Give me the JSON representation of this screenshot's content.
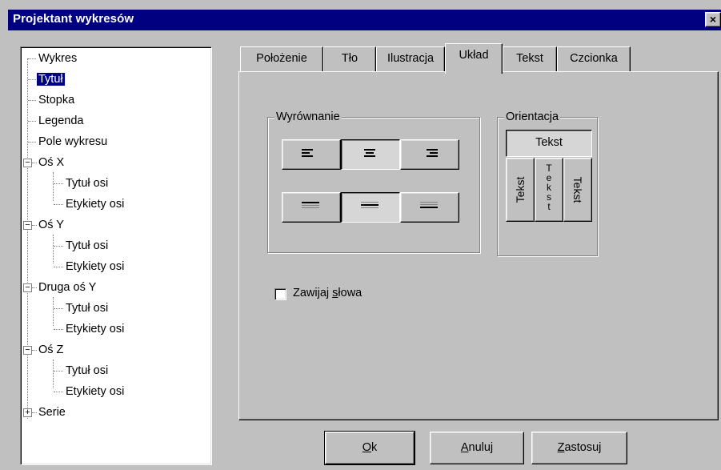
{
  "window": {
    "title": "Projektant wykresów",
    "close_glyph": "×"
  },
  "tree": {
    "items": [
      {
        "label": "Wykres"
      },
      {
        "label": "Tytuł",
        "selected": true
      },
      {
        "label": "Stopka"
      },
      {
        "label": "Legenda"
      },
      {
        "label": "Pole wykresu"
      },
      {
        "label": "Oś X",
        "expander": "−"
      },
      {
        "label": "Tytuł osi"
      },
      {
        "label": "Etykiety osi"
      },
      {
        "label": "Oś Y",
        "expander": "−"
      },
      {
        "label": "Tytuł osi"
      },
      {
        "label": "Etykiety osi"
      },
      {
        "label": "Druga oś Y",
        "expander": "−"
      },
      {
        "label": "Tytuł osi"
      },
      {
        "label": "Etykiety osi"
      },
      {
        "label": "Oś Z",
        "expander": "−"
      },
      {
        "label": "Tytuł osi"
      },
      {
        "label": "Etykiety osi"
      },
      {
        "label": "Serie",
        "expander": "+"
      }
    ]
  },
  "tabs": [
    {
      "label": "Położenie"
    },
    {
      "label": "Tło"
    },
    {
      "label": "Ilustracja"
    },
    {
      "label": "Układ",
      "active": true
    },
    {
      "label": "Tekst"
    },
    {
      "label": "Czcionka"
    }
  ],
  "alignment": {
    "label": "Wyrównanie",
    "horizontal_selected": "center",
    "vertical_selected": "middle"
  },
  "orientation": {
    "label": "Orientacja",
    "horizontal_text": "Tekst",
    "vertical_text_1": "Tekst",
    "stacked_letters": [
      "T",
      "e",
      "k",
      "s",
      "t"
    ],
    "vertical_text_2": "Tekst",
    "selected": "horizontal"
  },
  "wrap_words": {
    "label_pre": "Zawijaj ",
    "label_key": "s",
    "label_post": "łowa",
    "checked": false
  },
  "buttons": {
    "ok": {
      "key": "O",
      "rest": "k"
    },
    "cancel": {
      "key": "A",
      "rest": "nuluj"
    },
    "apply": {
      "key": "Z",
      "rest": "astosuj"
    }
  },
  "icons": {
    "close": "close-icon",
    "align_left": "align-left-icon",
    "align_center": "align-center-icon",
    "align_right": "align-right-icon",
    "valign_top": "align-top-icon",
    "valign_middle": "align-middle-icon",
    "valign_bottom": "align-bottom-icon"
  }
}
